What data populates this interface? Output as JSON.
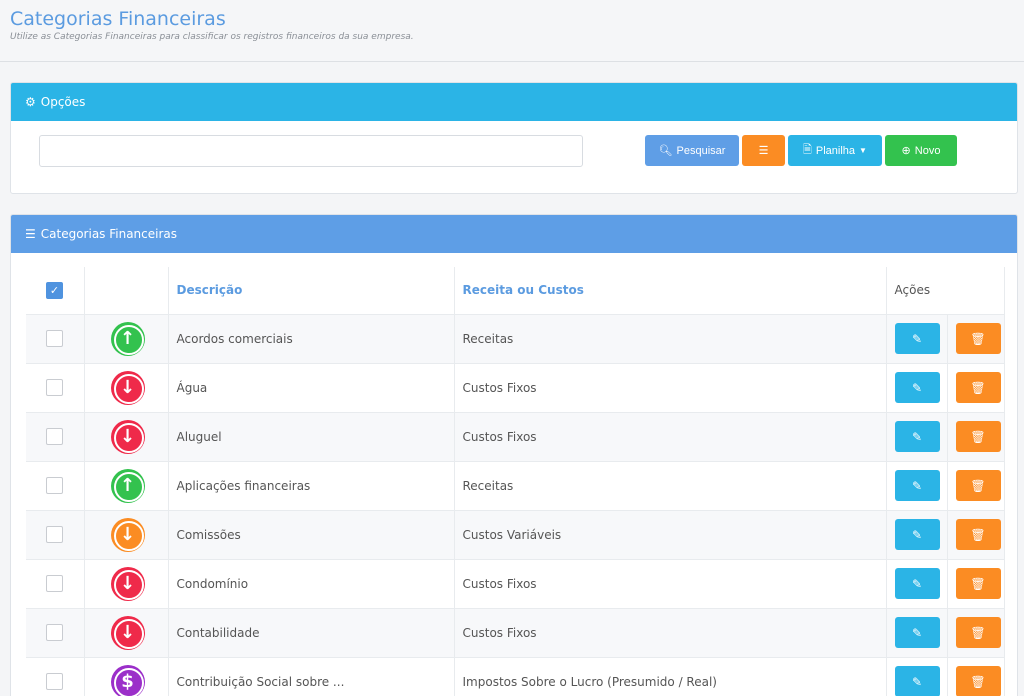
{
  "header": {
    "title": "Categorias Financeiras",
    "subtitle": "Utilize as Categorias Financeiras para classificar os registros financeiros da sua empresa."
  },
  "options_panel": {
    "title": "Opções",
    "search": {
      "value": "",
      "placeholder": ""
    },
    "buttons": {
      "search": "Pesquisar",
      "sheet": "Planilha",
      "new": "Novo"
    }
  },
  "list_panel": {
    "title": "Categorias Financeiras",
    "columns": {
      "description": "Descrição",
      "type": "Receita ou Custos",
      "actions": "Ações"
    },
    "rows": [
      {
        "description": "Acordos comerciais",
        "type": "Receitas",
        "icon": "arrow-up-icon",
        "color": "#33c24e",
        "glyph": "↑"
      },
      {
        "description": "Água",
        "type": "Custos Fixos",
        "icon": "arrow-down-icon",
        "color": "#ef2a4a",
        "glyph": "↓"
      },
      {
        "description": "Aluguel",
        "type": "Custos Fixos",
        "icon": "arrow-down-icon",
        "color": "#ef2a4a",
        "glyph": "↓"
      },
      {
        "description": "Aplicações financeiras",
        "type": "Receitas",
        "icon": "arrow-up-icon",
        "color": "#33c24e",
        "glyph": "↑"
      },
      {
        "description": "Comissões",
        "type": "Custos Variáveis",
        "icon": "arrow-down-icon",
        "color": "#fb8c23",
        "glyph": "↓"
      },
      {
        "description": "Condomínio",
        "type": "Custos Fixos",
        "icon": "arrow-down-icon",
        "color": "#ef2a4a",
        "glyph": "↓"
      },
      {
        "description": "Contabilidade",
        "type": "Custos Fixos",
        "icon": "arrow-down-icon",
        "color": "#ef2a4a",
        "glyph": "↓"
      },
      {
        "description": "Contribuição Social sobre ...",
        "type": "Impostos Sobre o Lucro (Presumido / Real)",
        "icon": "dollar-icon",
        "color": "#9b2fc9",
        "glyph": "$"
      }
    ]
  },
  "colors": {
    "primary_blue": "#5e9ee6",
    "info_cyan": "#2bb4e6",
    "orange": "#fb8c23",
    "green": "#33c24e",
    "red": "#ef2a4a",
    "purple": "#9b2fc9"
  }
}
